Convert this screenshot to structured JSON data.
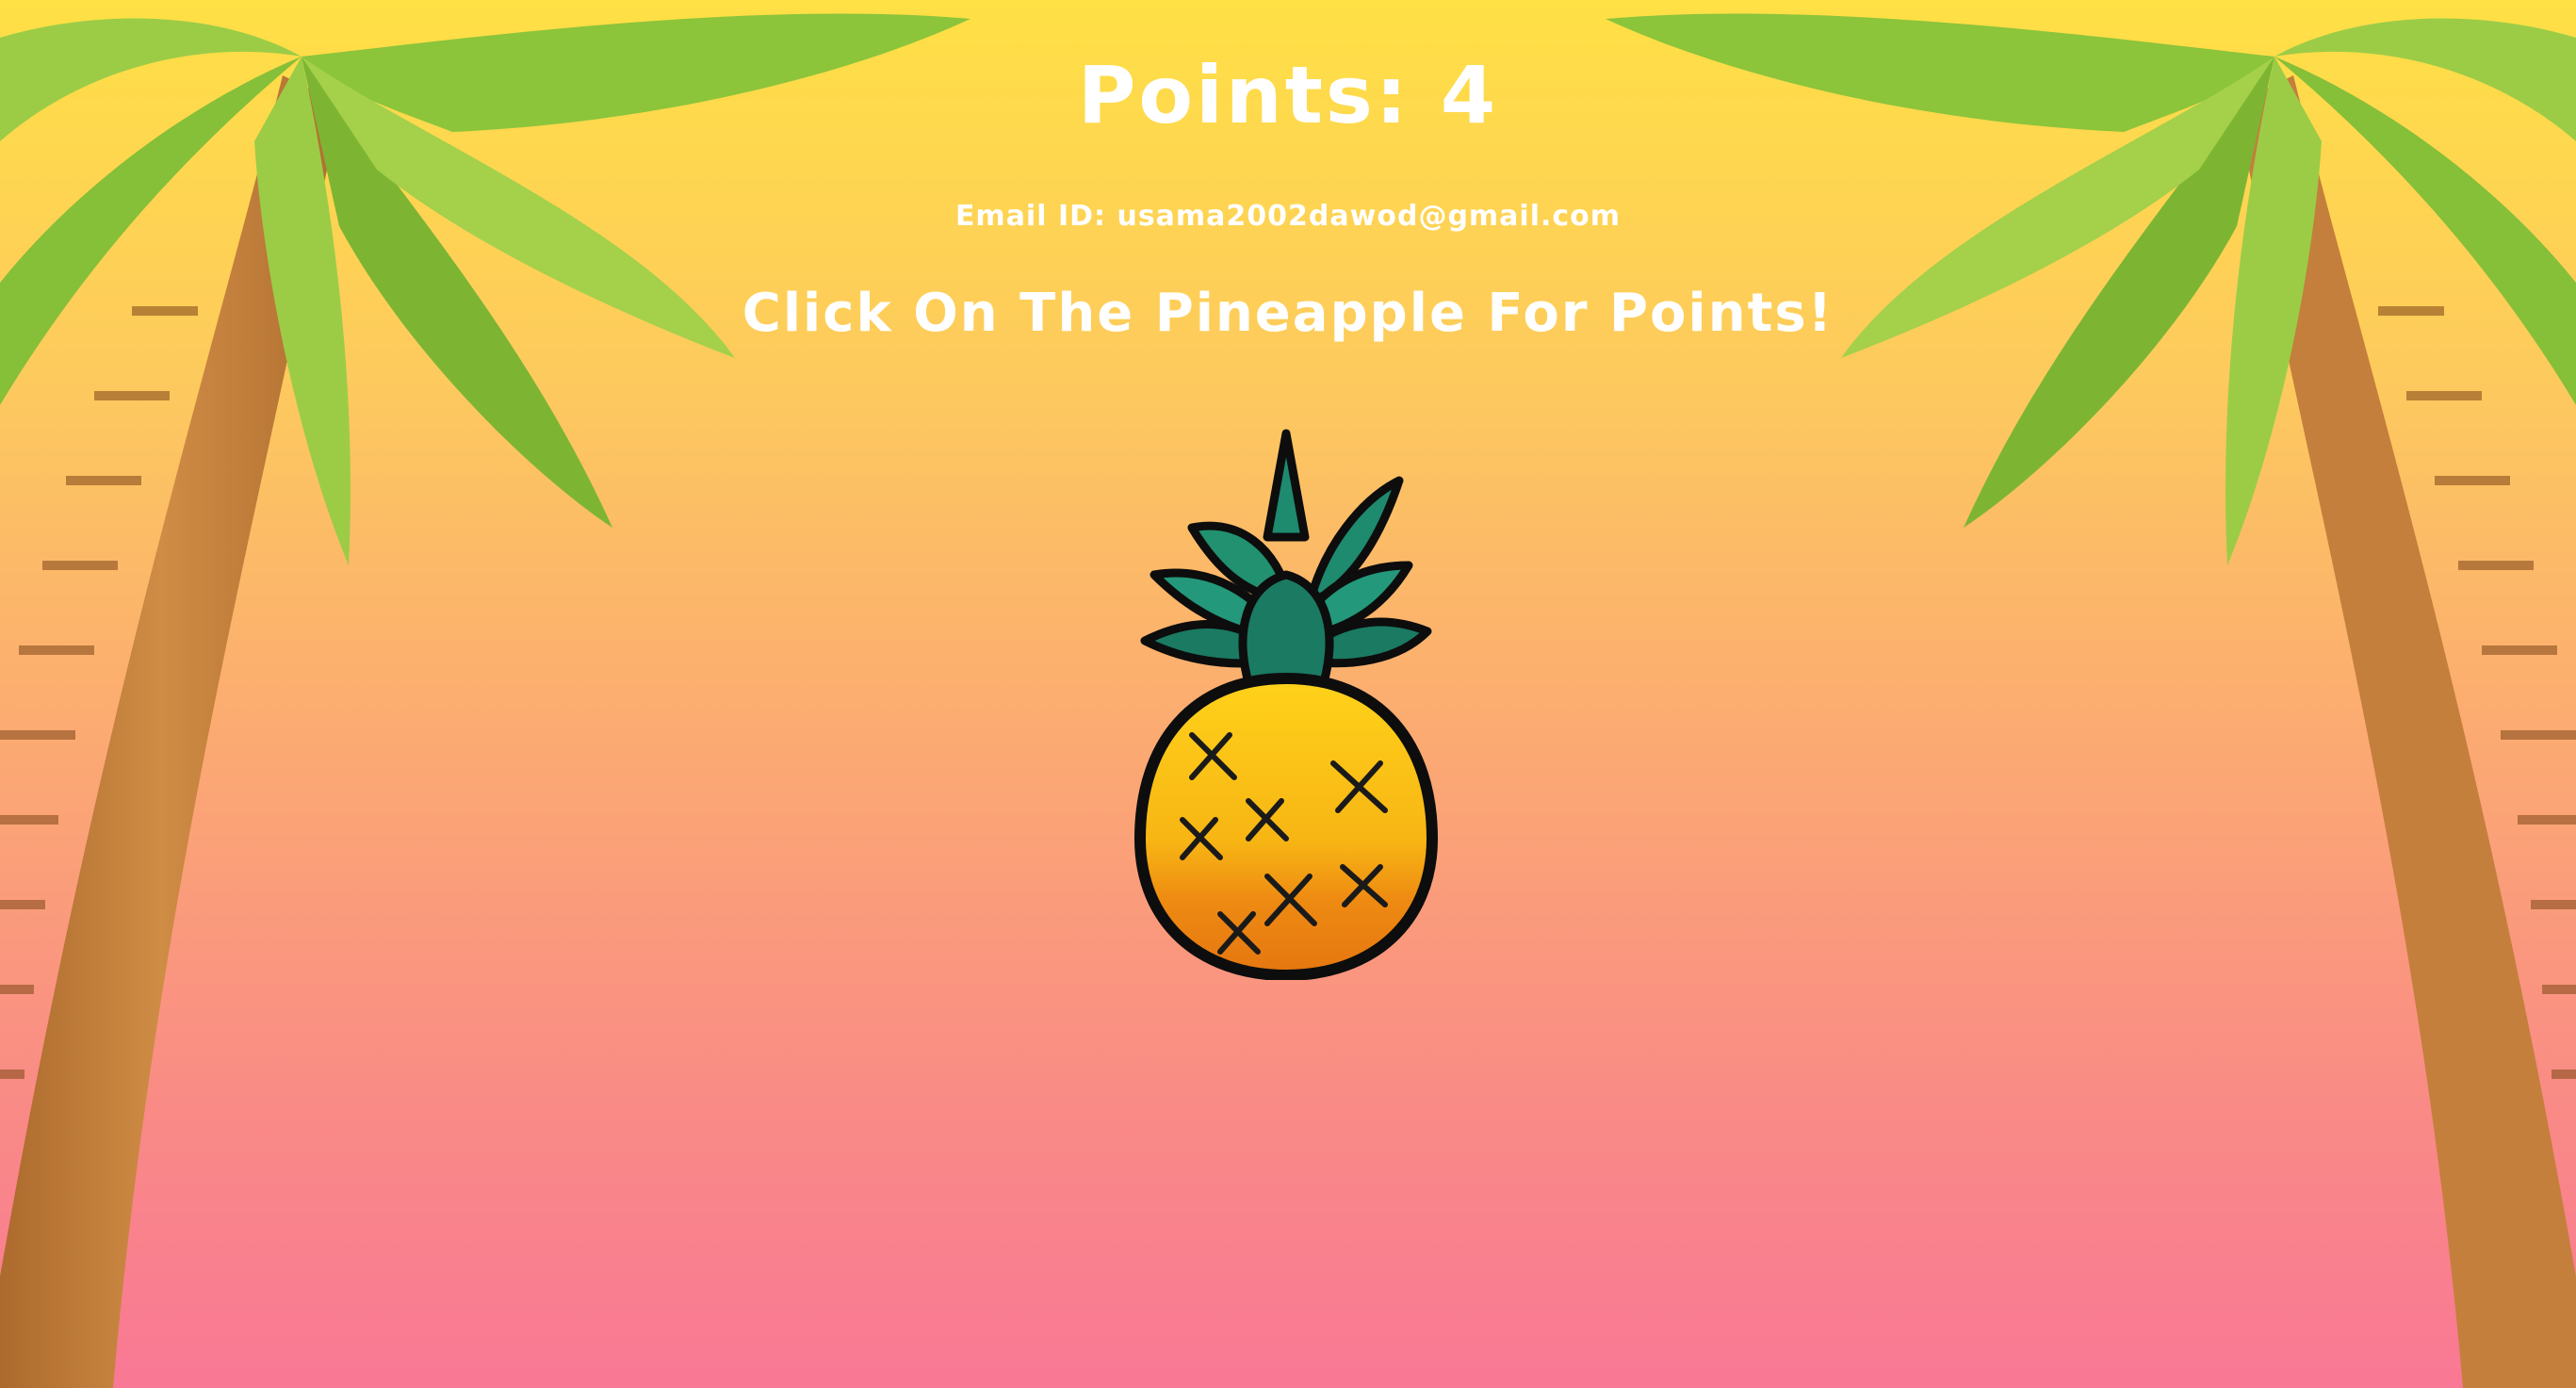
{
  "game": {
    "points_label": "Points:",
    "points_value": "4",
    "email_label": "Email ID:",
    "email_value": "usama2002dawod@gmail.com",
    "instruction": "Click On The Pineapple For Points!"
  },
  "theme": {
    "sky_top": "#ffe045",
    "sky_bottom": "#f97895",
    "text": "#ffffff",
    "palm_leaf": "#8cc43a",
    "palm_trunk": "#c98840",
    "pineapple_leaf": "#1e8a6e",
    "pineapple_body": "#f5b515"
  }
}
